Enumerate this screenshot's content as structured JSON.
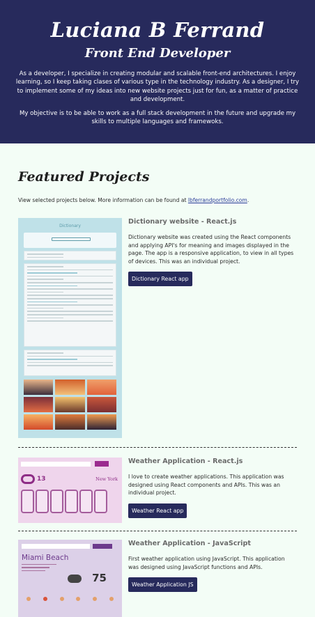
{
  "header": {
    "name": "Luciana B Ferrand",
    "role": "Front End Developer",
    "bio_1": "As a developer, I specialize in creating modular and scalable front-end architectures. I enjoy learning, so I keep taking clases of various type in the technology industry. As a designer, I try to implement some of my ideas into new website projects just for fun, as a matter of practice and development.",
    "bio_2": "My objective is to be able to work as a full stack development in the future and upgrade my skills to multiple languages and framewoks."
  },
  "projects_section": {
    "title": "Featured Projects",
    "intro": "View selected projects below. More information can be found at ",
    "link_text": "lbferrandportfolio.com",
    "intro_end": "."
  },
  "projects": [
    {
      "title": "Dictionary website - React.js",
      "description": "Dictionary website was created using the React components and applying API's for meaning and images displayed in the page. The app is a responsive application, to view in all types of devices. This was an individual project.",
      "button": "Dictionary React app",
      "thumbnail": {
        "app_title": "Dictionary",
        "search_word": "sunset"
      }
    },
    {
      "title": "Weather Application - React.js",
      "description": "I love to create weather applications. This application was designed using React components and APIs. This was an individual project.",
      "button": "Weather React app",
      "thumbnail": {
        "temperature": "13",
        "city": "New York"
      }
    },
    {
      "title": "Weather Application - JavaScript",
      "description": "First weather application using JavaScript. This application was designed using JavaScript functions and APIs.",
      "button": "Weather Application JS",
      "thumbnail": {
        "city": "Miami Beach",
        "temperature": "75"
      }
    }
  ],
  "colors": {
    "header_bg": "#272a5c",
    "page_bg": "#f3fdf6",
    "button_bg": "#272a5c",
    "link": "#2c3d9a"
  }
}
